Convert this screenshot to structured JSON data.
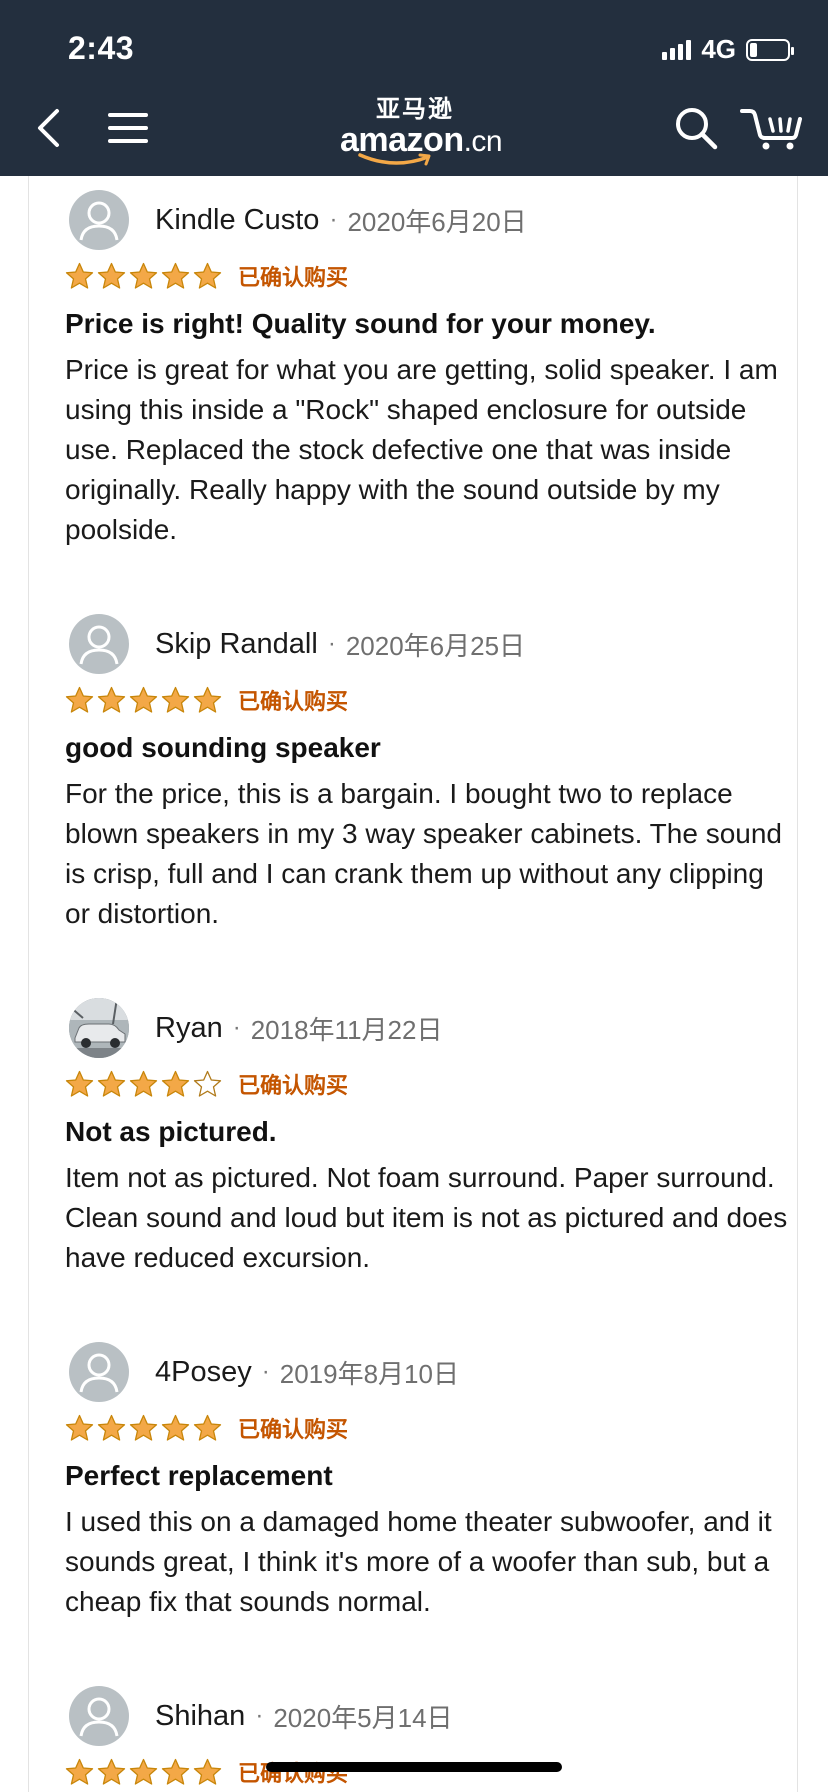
{
  "status_bar": {
    "time": "2:43",
    "network": "4G",
    "battery_level": 0.2
  },
  "header": {
    "logo_cn": "亚马逊",
    "logo_en": "amazon",
    "logo_suffix": ".cn",
    "background_color": "#232f3e"
  },
  "icons": {
    "back": "chevron-left-icon",
    "menu": "hamburger-menu-icon",
    "search": "search-icon",
    "cart": "cart-icon"
  },
  "colors": {
    "star": "#f3a847",
    "verified": "#c45500"
  },
  "reviews": [
    {
      "reviewer": "Kindle Custo",
      "date": "2020年6月20日",
      "rating": 5,
      "verified_label": "已确认购买",
      "title": "Price is right! Quality sound for your money.",
      "body": "Price is great for what you are getting, solid speaker. I am using this inside a \"Rock\" shaped enclosure for outside use. Replaced the stock defective one that was inside originally. Really happy with the sound outside by my poolside."
    },
    {
      "reviewer": "Skip Randall",
      "date": "2020年6月25日",
      "rating": 5,
      "verified_label": "已确认购买",
      "title": "good sounding speaker",
      "body": "For the price, this is a bargain. I bought two to replace blown speakers in my 3 way speaker cabinets. The sound is crisp, full and I can crank them up without any clipping or distortion."
    },
    {
      "reviewer": "Ryan",
      "date": "2018年11月22日",
      "rating": 4,
      "verified_label": "已确认购买",
      "title": "Not as pictured.",
      "body": "Item not as pictured. Not foam surround. Paper surround. Clean sound and loud but item is not as pictured and does have reduced excursion."
    },
    {
      "reviewer": "4Posey",
      "date": "2019年8月10日",
      "rating": 5,
      "verified_label": "已确认购买",
      "title": "Perfect replacement",
      "body": "I used this on a damaged home theater subwoofer, and it sounds great, I think it's more of a woofer than sub, but a cheap fix that sounds normal."
    },
    {
      "reviewer": "Shihan",
      "date": "2020年5月14日",
      "rating": 5,
      "verified_label": "已确认购买",
      "title": "",
      "body": ""
    }
  ]
}
